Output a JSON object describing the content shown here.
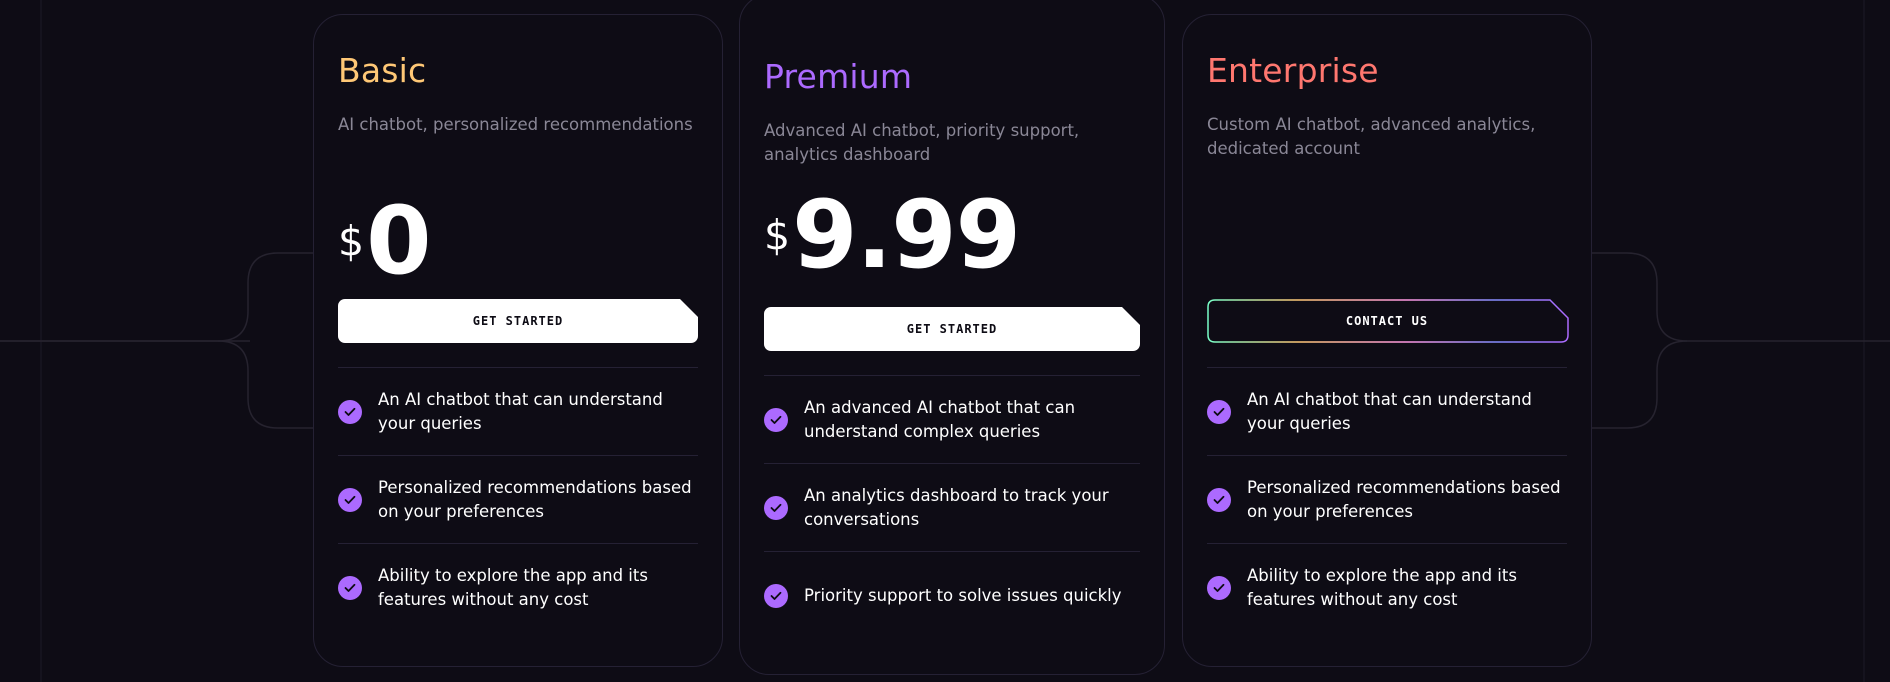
{
  "plans": [
    {
      "name": "Basic",
      "color": "#ffc876",
      "description": "AI chatbot, personalized recommendations",
      "currency": "$",
      "price": "0",
      "button_label": "GET STARTED",
      "features": [
        "An AI chatbot that can understand your queries",
        "Personalized recommendations based on your preferences",
        "Ability to explore the app and its features without any cost"
      ]
    },
    {
      "name": "Premium",
      "color": "#ac6aff",
      "description": "Advanced AI chatbot, priority support, analytics dashboard",
      "currency": "$",
      "price": "9.99",
      "button_label": "GET STARTED",
      "features": [
        "An advanced AI chatbot that can understand complex queries",
        "An analytics dashboard to track your conversations",
        "Priority support to solve issues quickly"
      ]
    },
    {
      "name": "Enterprise",
      "color": "#ff776f",
      "description": "Custom AI chatbot, advanced analytics, dedicated account",
      "button_label": "CONTACT US",
      "features": [
        "An AI chatbot that can understand your queries",
        "Personalized recommendations based on your preferences",
        "Ability to explore the app and its features without any cost"
      ]
    }
  ],
  "icons": {
    "feature_check": "check-icon"
  },
  "colors": {
    "background": "#0e0c15",
    "border": "#252134",
    "check_bg": "#ac6aff",
    "button_light": "#ffffff"
  }
}
